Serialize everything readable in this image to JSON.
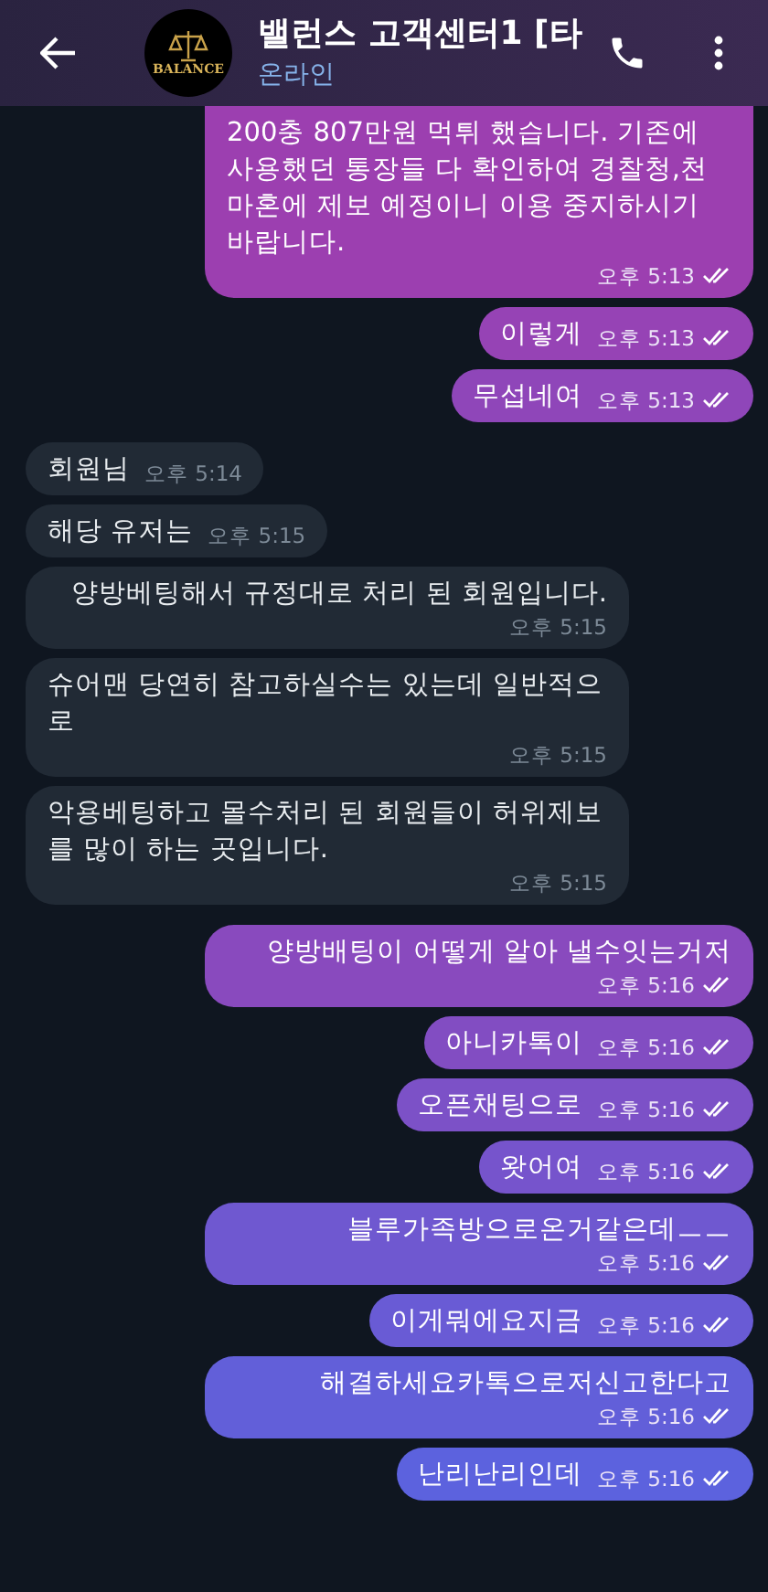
{
  "header": {
    "title": "밸런스 고객센터1 [타",
    "status": "온라인",
    "avatar_text": "BALANCE"
  },
  "messages": [
    {
      "kind": "out",
      "text": "200충 807만원 먹튀 했습니다. 기존에 사용했던 통장들 다 확인하여 경찰청,천마혼에 제보 예정이니 이용 중지하시기 바랍니다.",
      "time": "오후 5:13",
      "read": true
    },
    {
      "kind": "out",
      "text": "이렇게",
      "time": "오후 5:13",
      "read": true
    },
    {
      "kind": "out",
      "text": "무섭네여",
      "time": "오후 5:13",
      "read": true
    },
    {
      "kind": "in",
      "text": "회원님",
      "time": "오후 5:14"
    },
    {
      "kind": "in",
      "text": "해당 유저는",
      "time": "오후 5:15"
    },
    {
      "kind": "in",
      "text": "양방베팅해서 규정대로 처리 된 회원입니다.",
      "time": "오후 5:15"
    },
    {
      "kind": "in",
      "text": "슈어맨 당연히 참고하실수는 있는데 일반적으로",
      "time": "오후 5:15"
    },
    {
      "kind": "in",
      "text": "악용베팅하고 몰수처리 된 회원들이 허위제보를 많이 하는 곳입니다.",
      "time": "오후 5:15"
    },
    {
      "kind": "out",
      "text": "양방배팅이 어떻게 알아 낼수잇는거저",
      "time": "오후 5:16",
      "read": true
    },
    {
      "kind": "out",
      "text": "아니카톡이",
      "time": "오후 5:16",
      "read": true
    },
    {
      "kind": "out",
      "text": "오픈채팅으로",
      "time": "오후 5:16",
      "read": true
    },
    {
      "kind": "out",
      "text": "왓어여",
      "time": "오후 5:16",
      "read": true
    },
    {
      "kind": "out",
      "text": "블루가족방으로온거같은데ㅡㅡ",
      "time": "오후 5:16",
      "read": true
    },
    {
      "kind": "out",
      "text": "이게뭐에요지금",
      "time": "오후 5:16",
      "read": true
    },
    {
      "kind": "out",
      "text": "해결하세요카톡으로저신고한다고",
      "time": "오후 5:16",
      "read": true
    },
    {
      "kind": "out",
      "text": "난리난리인데",
      "time": "오후 5:16",
      "read": true
    }
  ]
}
